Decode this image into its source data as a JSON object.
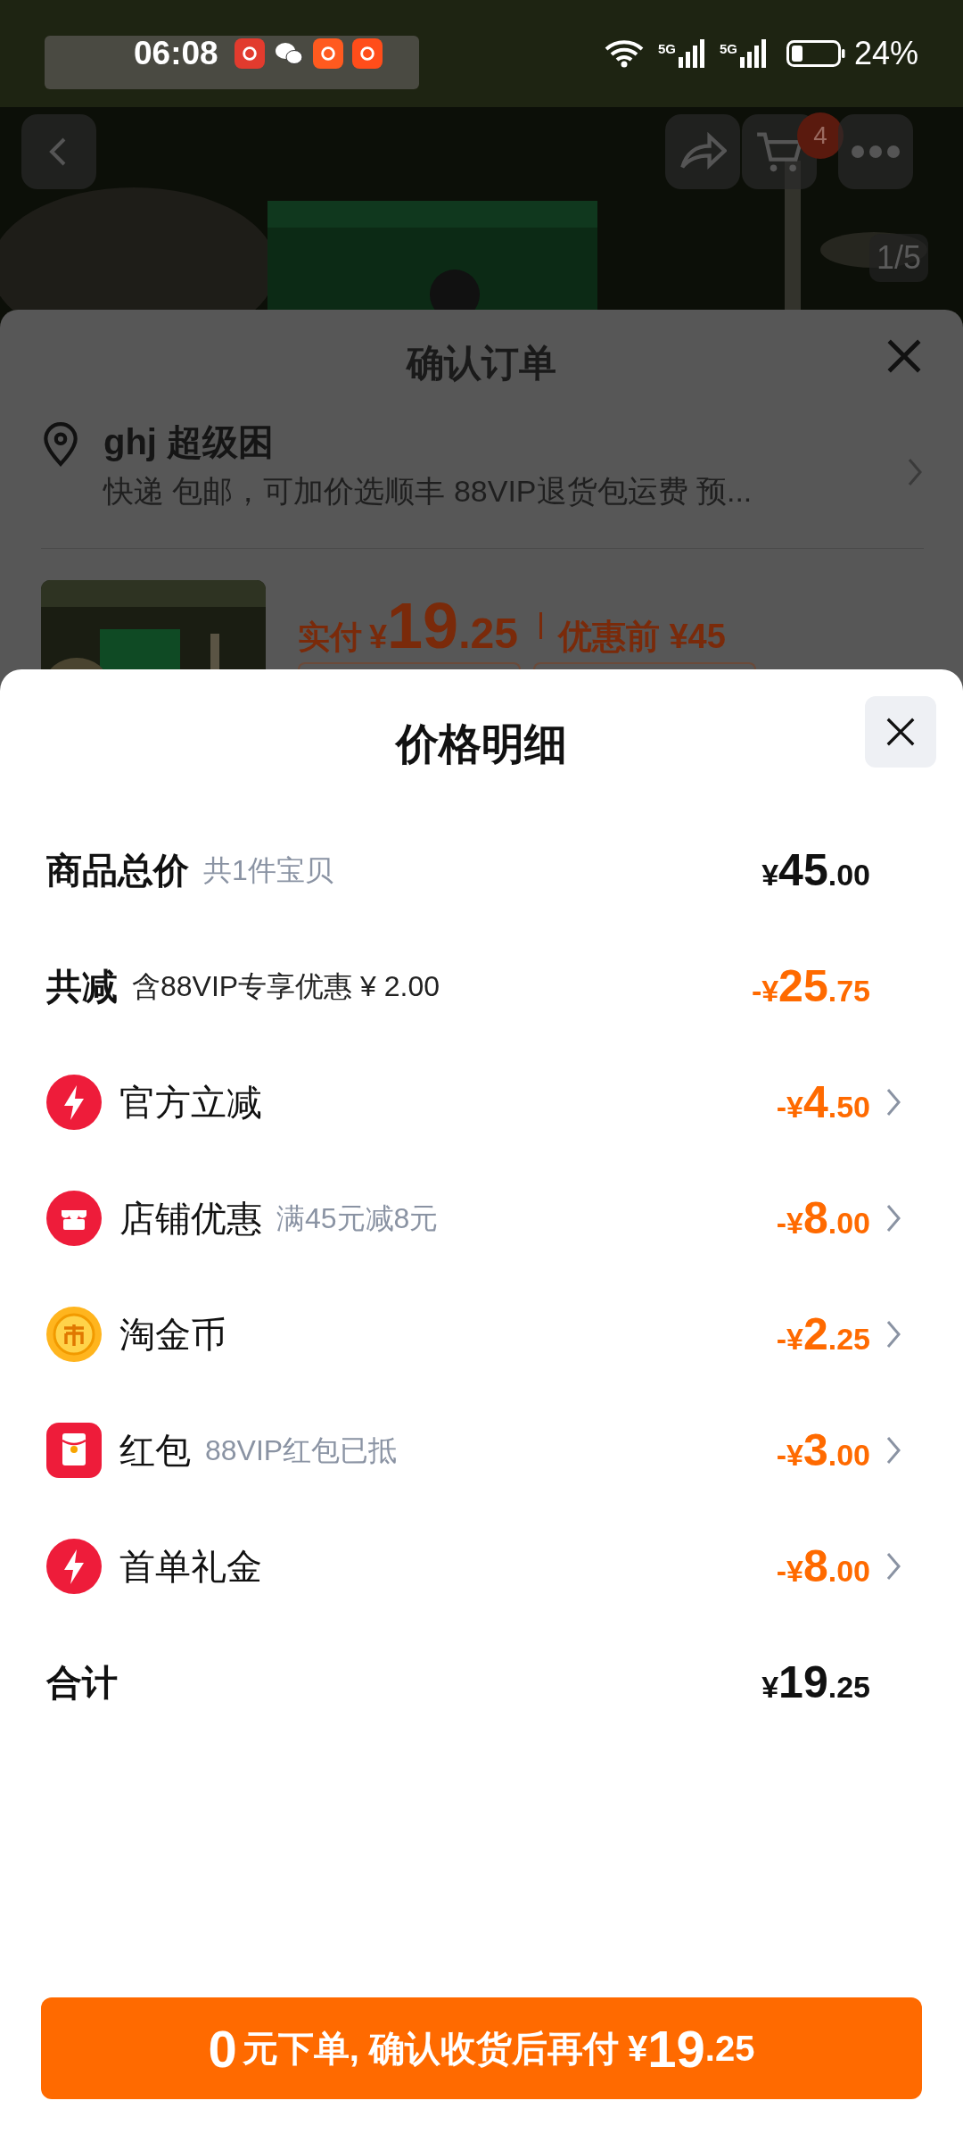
{
  "status_bar": {
    "time": "06:08",
    "battery": "24%",
    "network": [
      "5G",
      "5G"
    ]
  },
  "product_header": {
    "cart_badge": "4",
    "image_counter": "1/5"
  },
  "order_sheet": {
    "title": "确认订单",
    "address_name": "ghj 超级困",
    "shipping": "快递 包邮，可加价选顺丰 88VIP退货包运费 预...",
    "paid_label": "实付",
    "paid_currency": "¥",
    "paid_integer": "19",
    "paid_decimal": ".25",
    "before_label": "优惠前 ¥45"
  },
  "price_sheet": {
    "title": "价格明细",
    "rows": [
      {
        "kind": "plain",
        "label": "商品总价",
        "note": "共1件宝贝",
        "highlighted": false,
        "sign": "¥",
        "integer": "45",
        "decimal": ".00",
        "expandable": false
      },
      {
        "kind": "plain",
        "label": "共减",
        "note": "含88VIP专享优惠 ¥ 2.00",
        "highlighted": true,
        "sign": "-¥",
        "integer": "25",
        "decimal": ".75",
        "expandable": false
      },
      {
        "kind": "lightning",
        "label": "官方立减",
        "highlighted": true,
        "sign": "-¥",
        "integer": "4",
        "decimal": ".50",
        "expandable": true
      },
      {
        "kind": "store",
        "label": "店铺优惠",
        "note": "满45元减8元",
        "highlighted": true,
        "sign": "-¥",
        "integer": "8",
        "decimal": ".00",
        "expandable": true
      },
      {
        "kind": "coin",
        "label": "淘金币",
        "highlighted": true,
        "sign": "-¥",
        "integer": "2",
        "decimal": ".25",
        "expandable": true
      },
      {
        "kind": "red_packet",
        "label": "红包",
        "note": "88VIP红包已抵",
        "highlighted": true,
        "sign": "-¥",
        "integer": "3",
        "decimal": ".00",
        "expandable": true
      },
      {
        "kind": "lightning",
        "label": "首单礼金",
        "highlighted": true,
        "sign": "-¥",
        "integer": "8",
        "decimal": ".00",
        "expandable": true
      },
      {
        "kind": "plain",
        "label": "合计",
        "highlighted": false,
        "sign": "¥",
        "integer": "19",
        "decimal": ".25",
        "expandable": false
      }
    ]
  },
  "submit_button": {
    "lead": "0",
    "text": "元下单, 确认收货后再付",
    "currency": "¥",
    "integer": "19",
    "decimal": ".25"
  }
}
